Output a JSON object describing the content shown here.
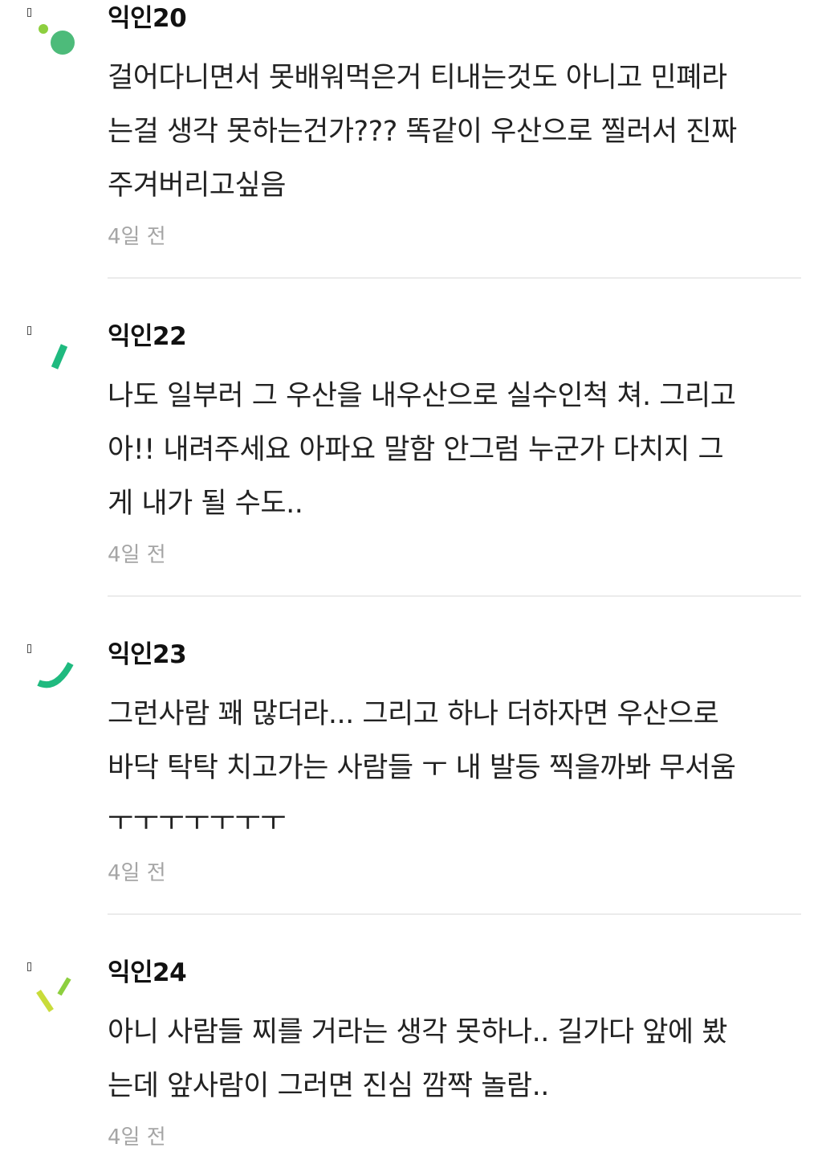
{
  "comments": [
    {
      "author": "익인20",
      "body": "걸어다니면서 못배워먹은거 티내는것도 아니고 민폐라\n는걸 생각 못하는건가??? 똑같이 우산으로 찔러서 진짜\n주겨버리고싶음",
      "time": "4일 전"
    },
    {
      "author": "익인22",
      "body": "나도 일부러 그 우산을 내우산으로 실수인척 쳐. 그리고\n아!! 내려주세요 아파요 말함 안그럼 누군가 다치지 그\n게 내가 될 수도..",
      "time": "4일 전"
    },
    {
      "author": "익인23",
      "body": "그런사람 꽤 많더라... 그리고 하나 더하자면 우산으로\n바닥 탁탁 치고가는 사람들 ㅜ 내 발등 찍을까봐 무서움\nㅜㅜㅜㅜㅜㅜㅜ",
      "time": "4일 전"
    },
    {
      "author": "익인24",
      "body": "아니 사람들 찌를 거라는 생각 못하나.. 길가다 앞에 봤\n는데 앞사람이 그러면 진심 깜짝 놀람..",
      "time": "4일 전"
    }
  ],
  "colors": {
    "avatar_green_light": "#8dcf3f",
    "avatar_green": "#4dbb7a",
    "avatar_green_teal": "#1fba7f",
    "avatar_lime": "#c9dc3a"
  }
}
